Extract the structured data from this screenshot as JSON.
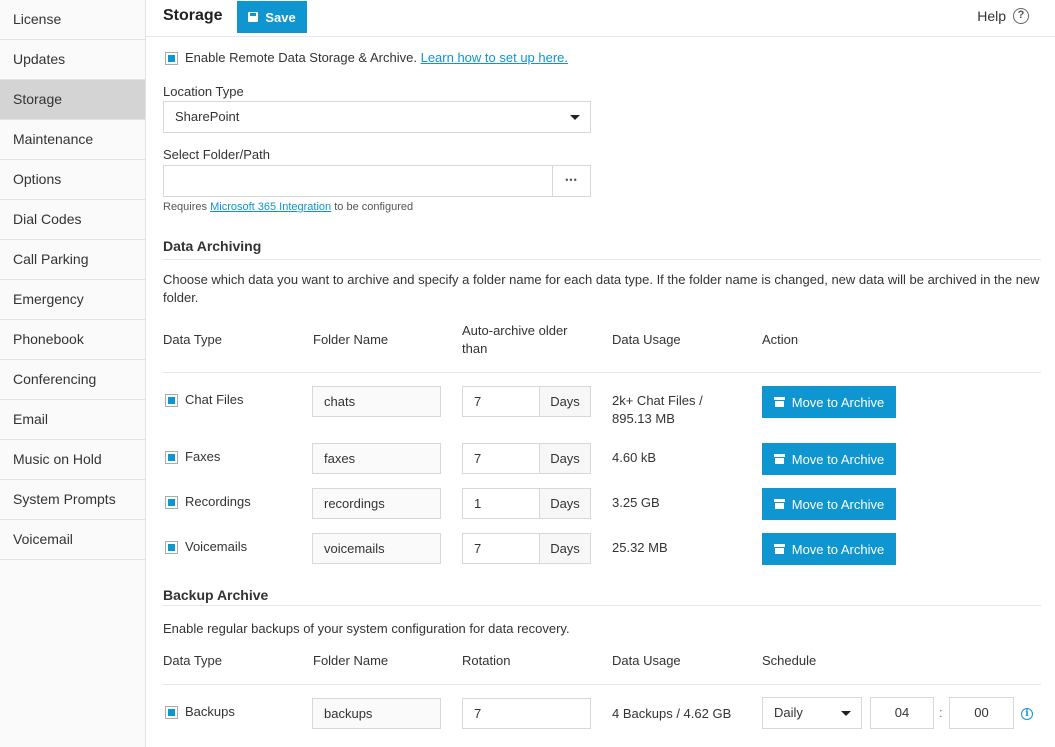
{
  "sidebar": {
    "items": [
      {
        "label": "License"
      },
      {
        "label": "Updates"
      },
      {
        "label": "Storage",
        "active": true
      },
      {
        "label": "Maintenance"
      },
      {
        "label": "Options"
      },
      {
        "label": "Dial Codes"
      },
      {
        "label": "Call Parking"
      },
      {
        "label": "Emergency"
      },
      {
        "label": "Phonebook"
      },
      {
        "label": "Conferencing"
      },
      {
        "label": "Email"
      },
      {
        "label": "Music on Hold"
      },
      {
        "label": "System Prompts"
      },
      {
        "label": "Voicemail"
      }
    ]
  },
  "header": {
    "title": "Storage",
    "save_label": "Save",
    "help_label": "Help",
    "help_icon": "?"
  },
  "remote": {
    "enable_label": "Enable Remote Data Storage & Archive.",
    "learn_link": "Learn how to set up here.",
    "location_label": "Location Type",
    "location_value": "SharePoint",
    "folder_label": "Select Folder/Path",
    "folder_value": "",
    "browse_label": "•••",
    "requires_prefix": "Requires",
    "requires_link": "Microsoft 365 Integration",
    "requires_suffix": "to be configured"
  },
  "archiving": {
    "heading": "Data Archiving",
    "description": "Choose which data you want to archive and specify a folder name for each data type. If the folder name is changed, new data will be archived in the new folder.",
    "columns": {
      "data_type": "Data Type",
      "folder_name": "Folder Name",
      "auto_archive_1": "Auto-archive older",
      "auto_archive_2": "than",
      "data_usage": "Data Usage",
      "action": "Action"
    },
    "rows": [
      {
        "type": "Chat Files",
        "folder": "chats",
        "days": "7",
        "unit": "Days",
        "usage_1": "2k+ Chat Files /",
        "usage_2": "895.13 MB",
        "action": "Move to Archive"
      },
      {
        "type": "Faxes",
        "folder": "faxes",
        "days": "7",
        "unit": "Days",
        "usage_1": "4.60 kB",
        "usage_2": "",
        "action": "Move to Archive"
      },
      {
        "type": "Recordings",
        "folder": "recordings",
        "days": "1",
        "unit": "Days",
        "usage_1": "3.25 GB",
        "usage_2": "",
        "action": "Move to Archive"
      },
      {
        "type": "Voicemails",
        "folder": "voicemails",
        "days": "7",
        "unit": "Days",
        "usage_1": "25.32 MB",
        "usage_2": "",
        "action": "Move to Archive"
      }
    ]
  },
  "backup": {
    "heading": "Backup Archive",
    "description": "Enable regular backups of your system configuration for data recovery.",
    "columns": {
      "data_type": "Data Type",
      "folder_name": "Folder Name",
      "rotation": "Rotation",
      "data_usage": "Data Usage",
      "schedule": "Schedule"
    },
    "row": {
      "type": "Backups",
      "folder": "backups",
      "rotation": "7",
      "usage": "4 Backups / 4.62 GB",
      "schedule": "Daily",
      "hour": "04",
      "separator": ":",
      "minute": "00",
      "info_icon": "i"
    }
  },
  "colors": {
    "accent": "#0f96d0",
    "sidebar_active": "#d4d4d4"
  }
}
